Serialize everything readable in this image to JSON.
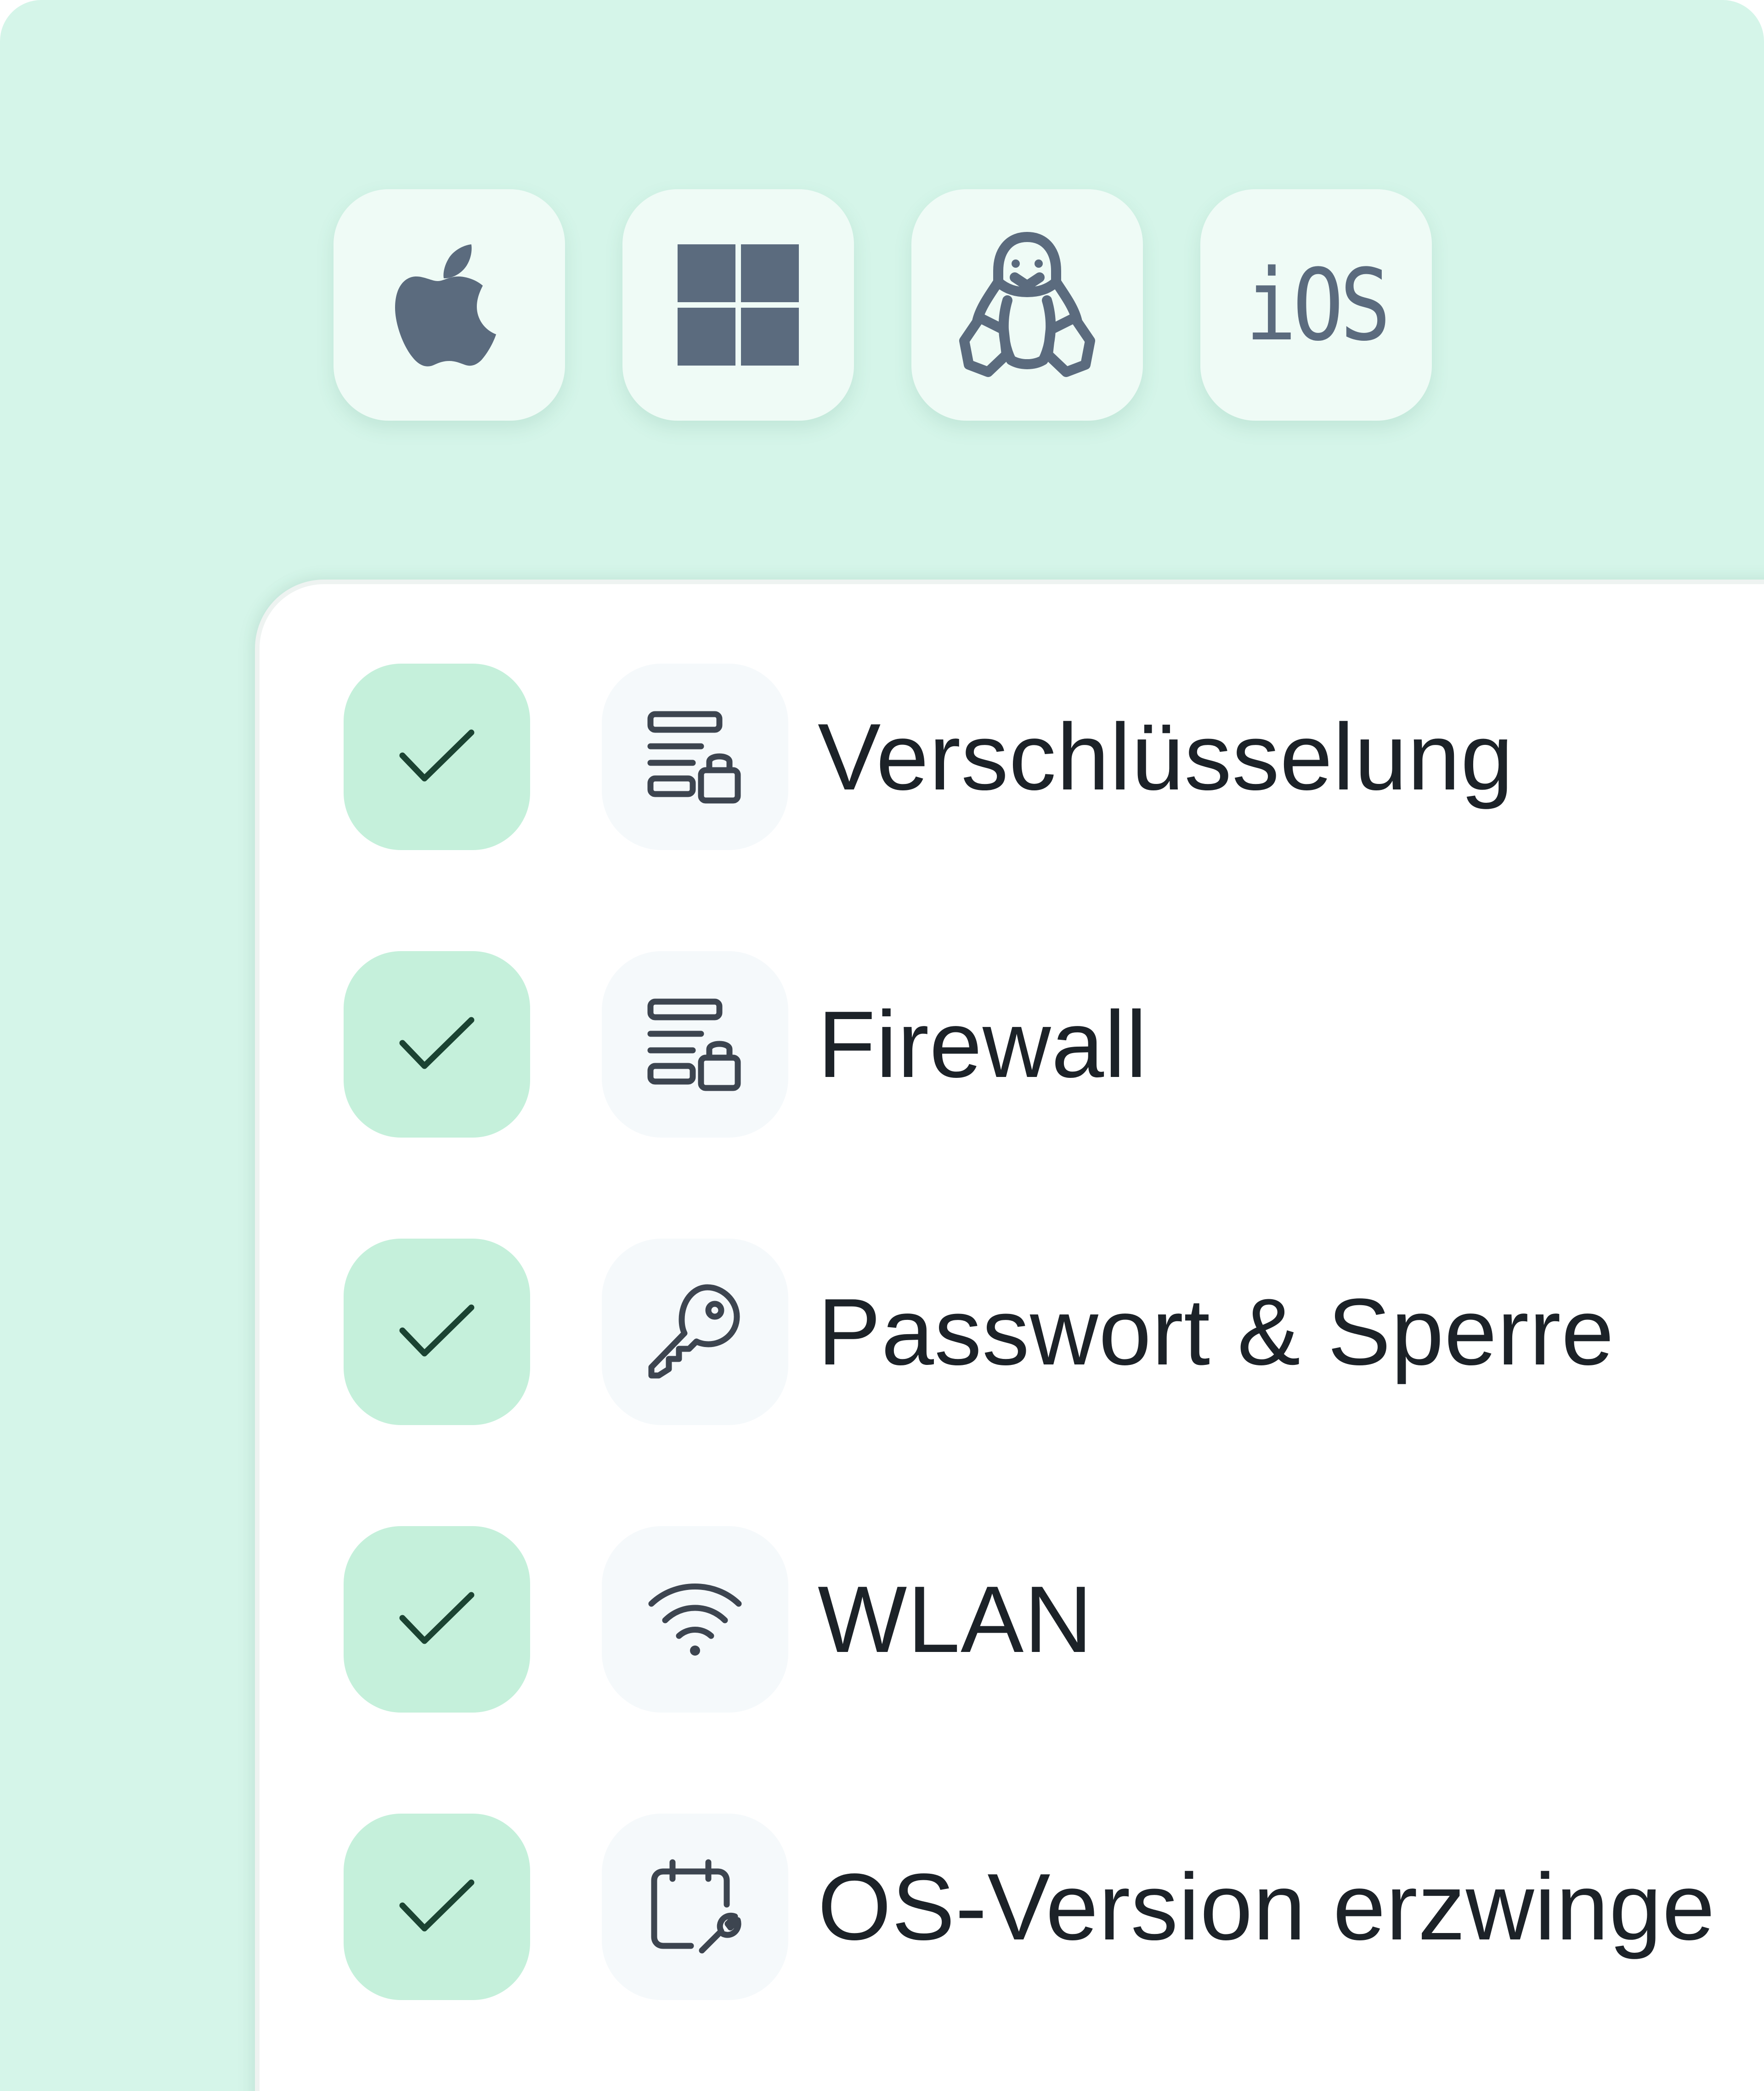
{
  "os_selector": {
    "platforms": [
      {
        "name": "macOS",
        "icon": "apple-icon"
      },
      {
        "name": "Windows",
        "icon": "windows-icon"
      },
      {
        "name": "Linux",
        "icon": "linux-tux-icon"
      },
      {
        "name": "iOS",
        "icon": "ios-icon",
        "label": "iOS"
      }
    ]
  },
  "checklist": {
    "items": [
      {
        "label": "Verschlüsselung",
        "icon": "encrypted-storage-icon",
        "checked": true
      },
      {
        "label": "Firewall",
        "icon": "encrypted-storage-icon",
        "checked": true
      },
      {
        "label": "Passwort & Sperre",
        "icon": "key-icon",
        "checked": true
      },
      {
        "label": "WLAN",
        "icon": "wifi-icon",
        "checked": true
      },
      {
        "label": "OS-Version erzwinge",
        "icon": "calendar-wrench-icon",
        "checked": true
      }
    ]
  },
  "colors": {
    "background": "#d5f5e9",
    "tile": "#effbf6",
    "icon_gray": "#5b6b7e",
    "check_bg": "#c5f0db",
    "check_mark": "#1b4332",
    "text": "#1c2228"
  }
}
